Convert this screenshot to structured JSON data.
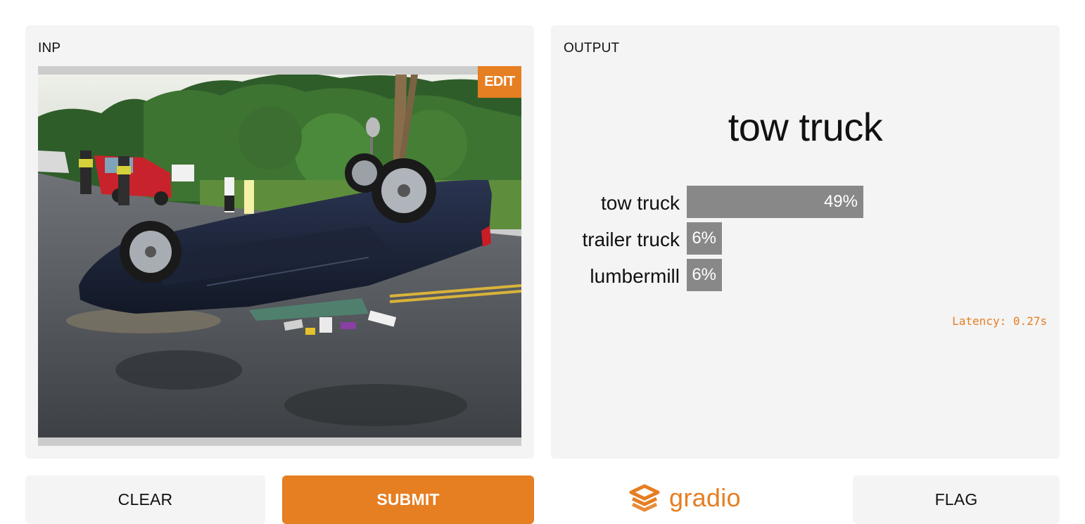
{
  "input": {
    "label": "INP",
    "edit_label": "EDIT"
  },
  "output": {
    "label": "OUTPUT",
    "top_label": "tow truck",
    "confidences": [
      {
        "label": "tow truck",
        "value_text": "49%",
        "fraction": 0.49
      },
      {
        "label": "trailer truck",
        "value_text": "6%",
        "fraction": 0.06
      },
      {
        "label": "lumbermill",
        "value_text": "6%",
        "fraction": 0.06
      }
    ],
    "latency": "Latency: 0.27s"
  },
  "buttons": {
    "clear": "CLEAR",
    "submit": "SUBMIT",
    "flag": "FLAG"
  },
  "brand": {
    "name": "gradio",
    "accent_color": "#e67e22"
  }
}
